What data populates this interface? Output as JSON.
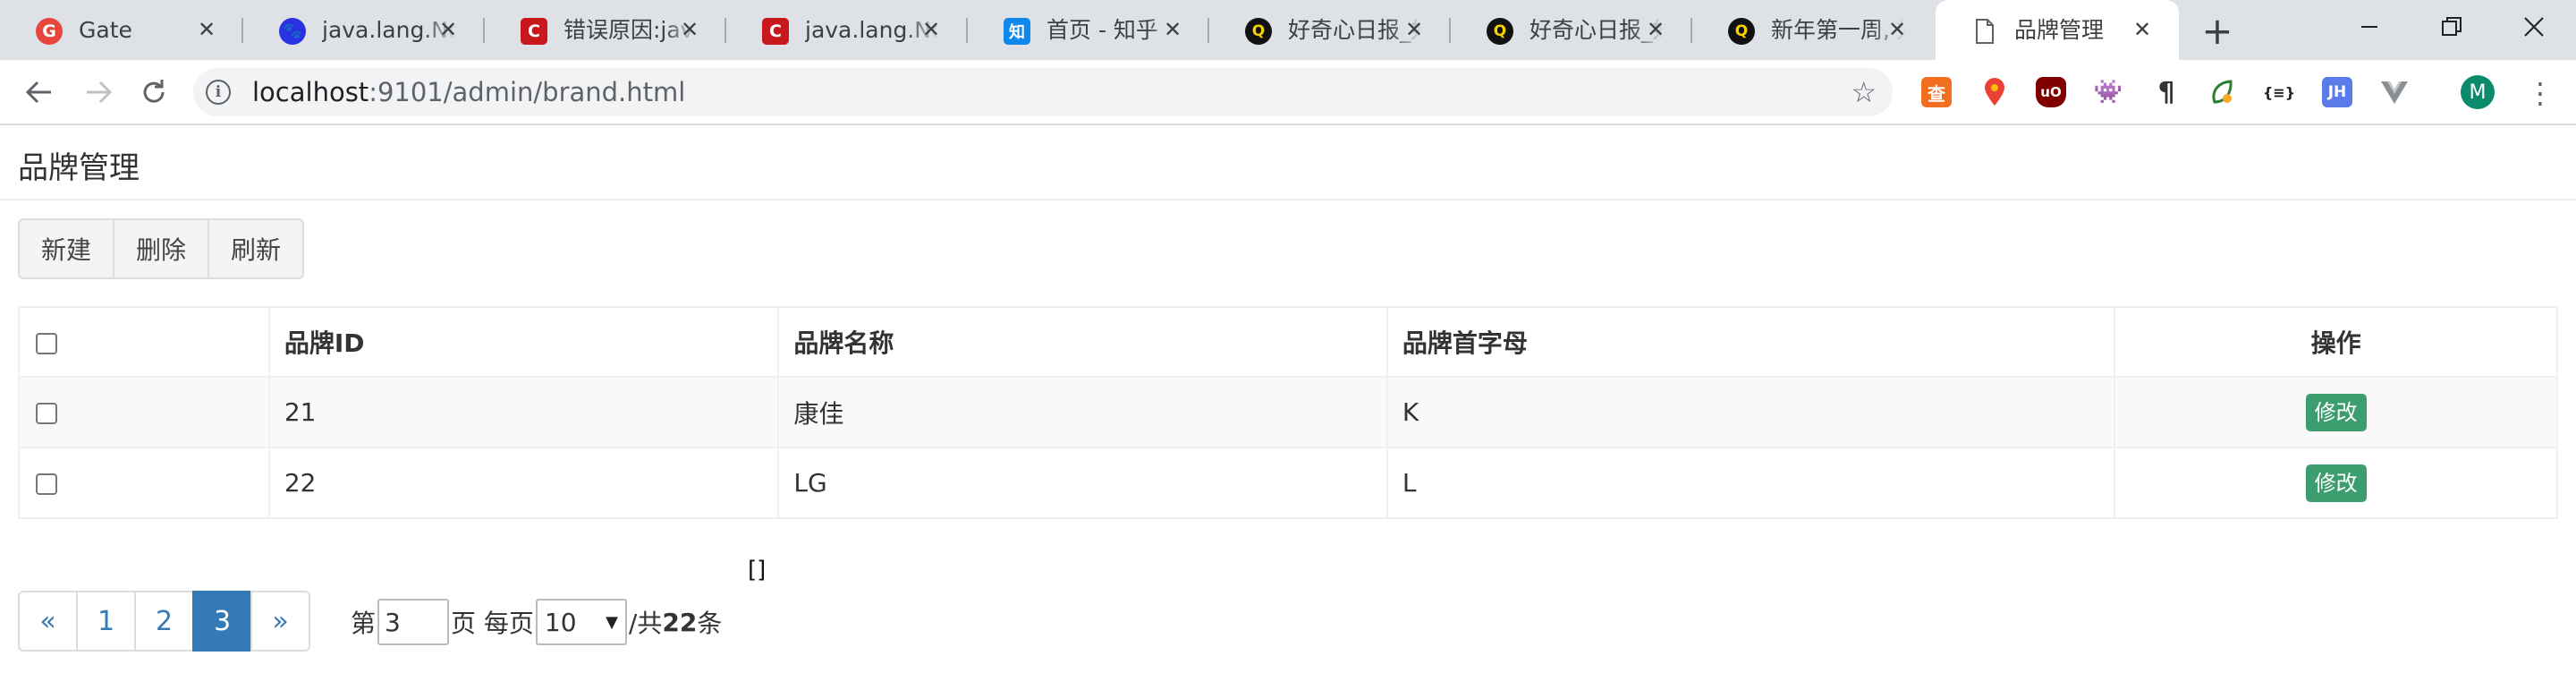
{
  "browser": {
    "tabs": [
      {
        "title": "Gate",
        "icon": "gate-icon",
        "color": "#e8453c"
      },
      {
        "title": "java.lang.NoSuchMethodError",
        "icon": "baidu-paw-icon",
        "color": "#2932e1"
      },
      {
        "title": "错误原因:java",
        "icon": "csdn-icon",
        "color": "#c9171e"
      },
      {
        "title": "java.lang.NoSuchMethodError",
        "icon": "csdn-icon",
        "color": "#c9171e"
      },
      {
        "title": "首页 - 知乎",
        "icon": "zhihu-icon",
        "color": "#0f88eb"
      },
      {
        "title": "好奇心日报_好奇心日报",
        "icon": "qdaily-icon",
        "color": "#111111"
      },
      {
        "title": "好奇心日报_好奇心日报",
        "icon": "qdaily-icon",
        "color": "#111111"
      },
      {
        "title": "新年第一周, 好奇心日报",
        "icon": "qdaily-icon",
        "color": "#111111"
      },
      {
        "title": "品牌管理",
        "icon": "page-icon",
        "color": "#5f6368",
        "active": true
      }
    ],
    "url_host": "localhost",
    "url_path": ":9101/admin/brand.html",
    "profile_initial": "M"
  },
  "page": {
    "title": "品牌管理",
    "toolbar": {
      "new": "新建",
      "delete": "删除",
      "refresh": "刷新"
    },
    "table": {
      "headers": {
        "id": "品牌ID",
        "name": "品牌名称",
        "letter": "品牌首字母",
        "op": "操作"
      },
      "rows": [
        {
          "id": "21",
          "name": "康佳",
          "letter": "K",
          "action": "修改"
        },
        {
          "id": "22",
          "name": "LG",
          "letter": "L",
          "action": "修改"
        }
      ]
    },
    "debug_output": "[]",
    "pagination": {
      "prev": "«",
      "pages": [
        "1",
        "2",
        "3"
      ],
      "current": "3",
      "next": "»",
      "label_page_prefix": "第",
      "page_input": "3",
      "label_page_suffix": "页 每页",
      "page_size": "10",
      "label_total_prefix": "/共",
      "total": "22",
      "label_total_suffix": "条"
    }
  }
}
